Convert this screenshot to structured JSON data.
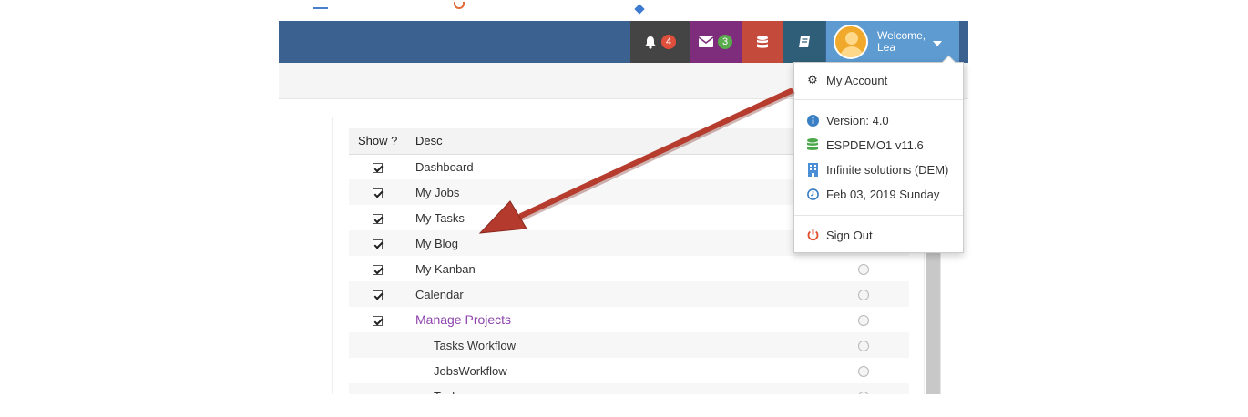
{
  "navbar": {
    "notifications_count": "4",
    "messages_count": "3",
    "user_welcome": "Welcome,",
    "user_name": "Lea"
  },
  "table": {
    "headers": [
      "Show ?",
      "Desc"
    ],
    "rows": [
      {
        "checked": true,
        "label": "Dashboard"
      },
      {
        "checked": true,
        "label": "My Jobs"
      },
      {
        "checked": true,
        "label": "My Tasks"
      },
      {
        "checked": true,
        "label": "My Blog"
      },
      {
        "checked": true,
        "label": "My Kanban"
      },
      {
        "checked": true,
        "label": "Calendar"
      },
      {
        "checked": true,
        "label": "Manage Projects"
      },
      {
        "checked": false,
        "label": "Tasks Workflow"
      },
      {
        "checked": false,
        "label": "JobsWorkflow"
      },
      {
        "checked": false,
        "label": "Tasks"
      }
    ]
  },
  "dropdown": {
    "my_account": "My Account",
    "version": "Version: 4.0",
    "database": "ESPDEMO1 v11.6",
    "company": "Infinite solutions (DEM)",
    "date": "Feb 03, 2019 Sunday",
    "sign_out": "Sign Out"
  },
  "colors": {
    "navbar": "#3b6191",
    "link": "#8e44ad",
    "arrow": "#c0392b"
  }
}
